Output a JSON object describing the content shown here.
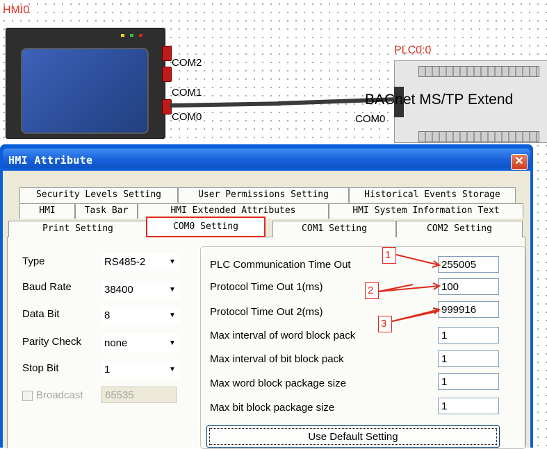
{
  "workspace": {
    "hmi_label": "HMI0",
    "ports": [
      "COM2",
      "COM1",
      "COM0"
    ],
    "plc_label": "PLC0:0",
    "plc_name": "BACnet MS/TP Extend",
    "plc_port": "COM0"
  },
  "dialog": {
    "title": "HMI Attribute",
    "close_glyph": "✕",
    "tabs_row1": [
      "Security Levels Setting",
      "User Permissions Setting",
      "Historical Events Storage"
    ],
    "tabs_row2": [
      "HMI",
      "Task Bar",
      "HMI Extended Attributes",
      "HMI System Information Text"
    ],
    "tabs_row3": [
      "Print Setting",
      "COM0 Setting",
      "COM1 Setting",
      "COM2 Setting"
    ],
    "active_tab": "COM0 Setting",
    "left": {
      "type_label": "Type",
      "type_value": "RS485-2",
      "baud_label": "Baud Rate",
      "baud_value": "38400",
      "databit_label": "Data Bit",
      "databit_value": "8",
      "parity_label": "Parity Check",
      "parity_value": "none",
      "stopbit_label": "Stop Bit",
      "stopbit_value": "1",
      "broadcast_label": "Broadcast",
      "broadcast_value": "65535"
    },
    "right": {
      "plc_timeout_label": "PLC Communication Time Out",
      "plc_timeout_value": "255005",
      "proto1_label": "Protocol Time Out 1(ms)",
      "proto1_value": "100",
      "proto2_label": "Protocol Time Out 2(ms)",
      "proto2_value": "999916",
      "max_word_interval_label": "Max interval of word block pack",
      "max_word_interval_value": "1",
      "max_bit_interval_label": "Max interval of bit block pack",
      "max_bit_interval_value": "1",
      "max_word_size_label": "Max word block package size",
      "max_word_size_value": "1",
      "max_bit_size_label": "Max bit block package size",
      "max_bit_size_value": "1"
    },
    "default_button": "Use Default Setting",
    "callouts": [
      "1",
      "2",
      "3"
    ]
  },
  "colors": {
    "callout": "#e02a1a",
    "title_bar": "#1660d8"
  }
}
